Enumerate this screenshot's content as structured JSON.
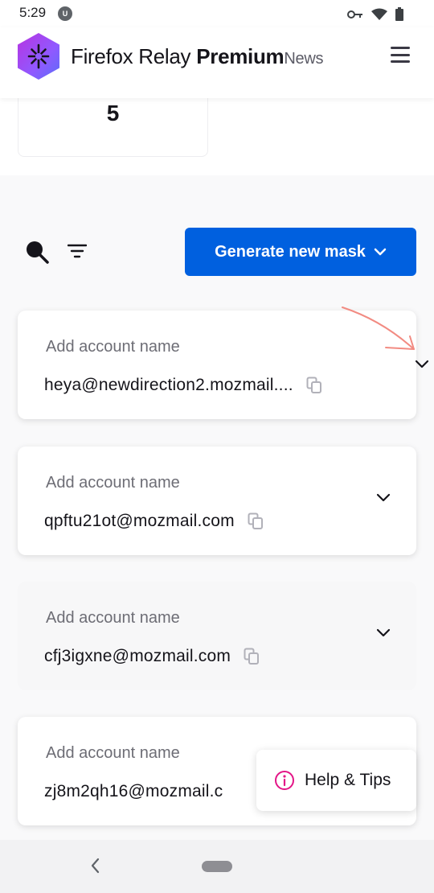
{
  "status": {
    "time": "5:29",
    "badge": "U"
  },
  "header": {
    "brand_firefox": "Firefox Relay",
    "brand_premium": "Premium",
    "news": "News"
  },
  "stats": {
    "value": "5"
  },
  "toolbar": {
    "generate_label": "Generate new mask"
  },
  "masks": [
    {
      "label": "Add account name",
      "email": "heya@newdirection2.mozmail...."
    },
    {
      "label": "Add account name",
      "email": "qpftu21ot@mozmail.com"
    },
    {
      "label": "Add account name",
      "email": "cfj3igxne@mozmail.com"
    },
    {
      "label": "Add account name",
      "email": "zj8m2qh16@mozmail.c"
    }
  ],
  "help": {
    "label": "Help & Tips"
  },
  "colors": {
    "primary": "#0060df",
    "help_accent": "#e31587",
    "annotation": "#f28b82"
  }
}
